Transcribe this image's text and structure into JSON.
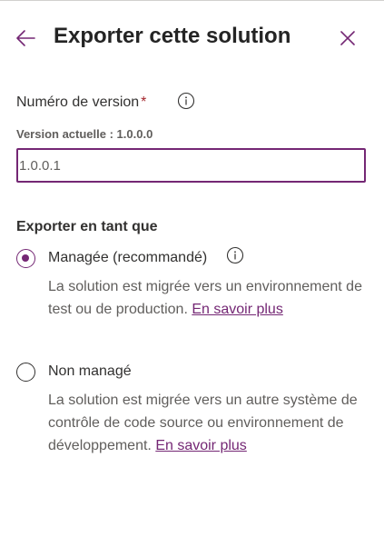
{
  "header": {
    "title": "Exporter cette solution",
    "back_icon": "arrow-left-icon",
    "close_icon": "close-icon"
  },
  "version_field": {
    "label": "Numéro de version",
    "required_marker": "*",
    "current_version_text": "Version actuelle : 1.0.0.0",
    "value": "1.0.0.1"
  },
  "export_as": {
    "section_title": "Exporter en tant que",
    "options": [
      {
        "label": "Managée (recommandé)",
        "selected": true,
        "description": "La solution est migrée vers un environnement de test ou de production. ",
        "link_text": "En savoir plus"
      },
      {
        "label": "Non managé",
        "selected": false,
        "description": "La solution est migrée vers un autre système de contrôle de code source ou environnement de développement. ",
        "link_text": "En savoir plus"
      }
    ]
  },
  "colors": {
    "accent": "#742774",
    "text": "#323130",
    "secondary_text": "#605e5c",
    "required": "#a4262c"
  }
}
